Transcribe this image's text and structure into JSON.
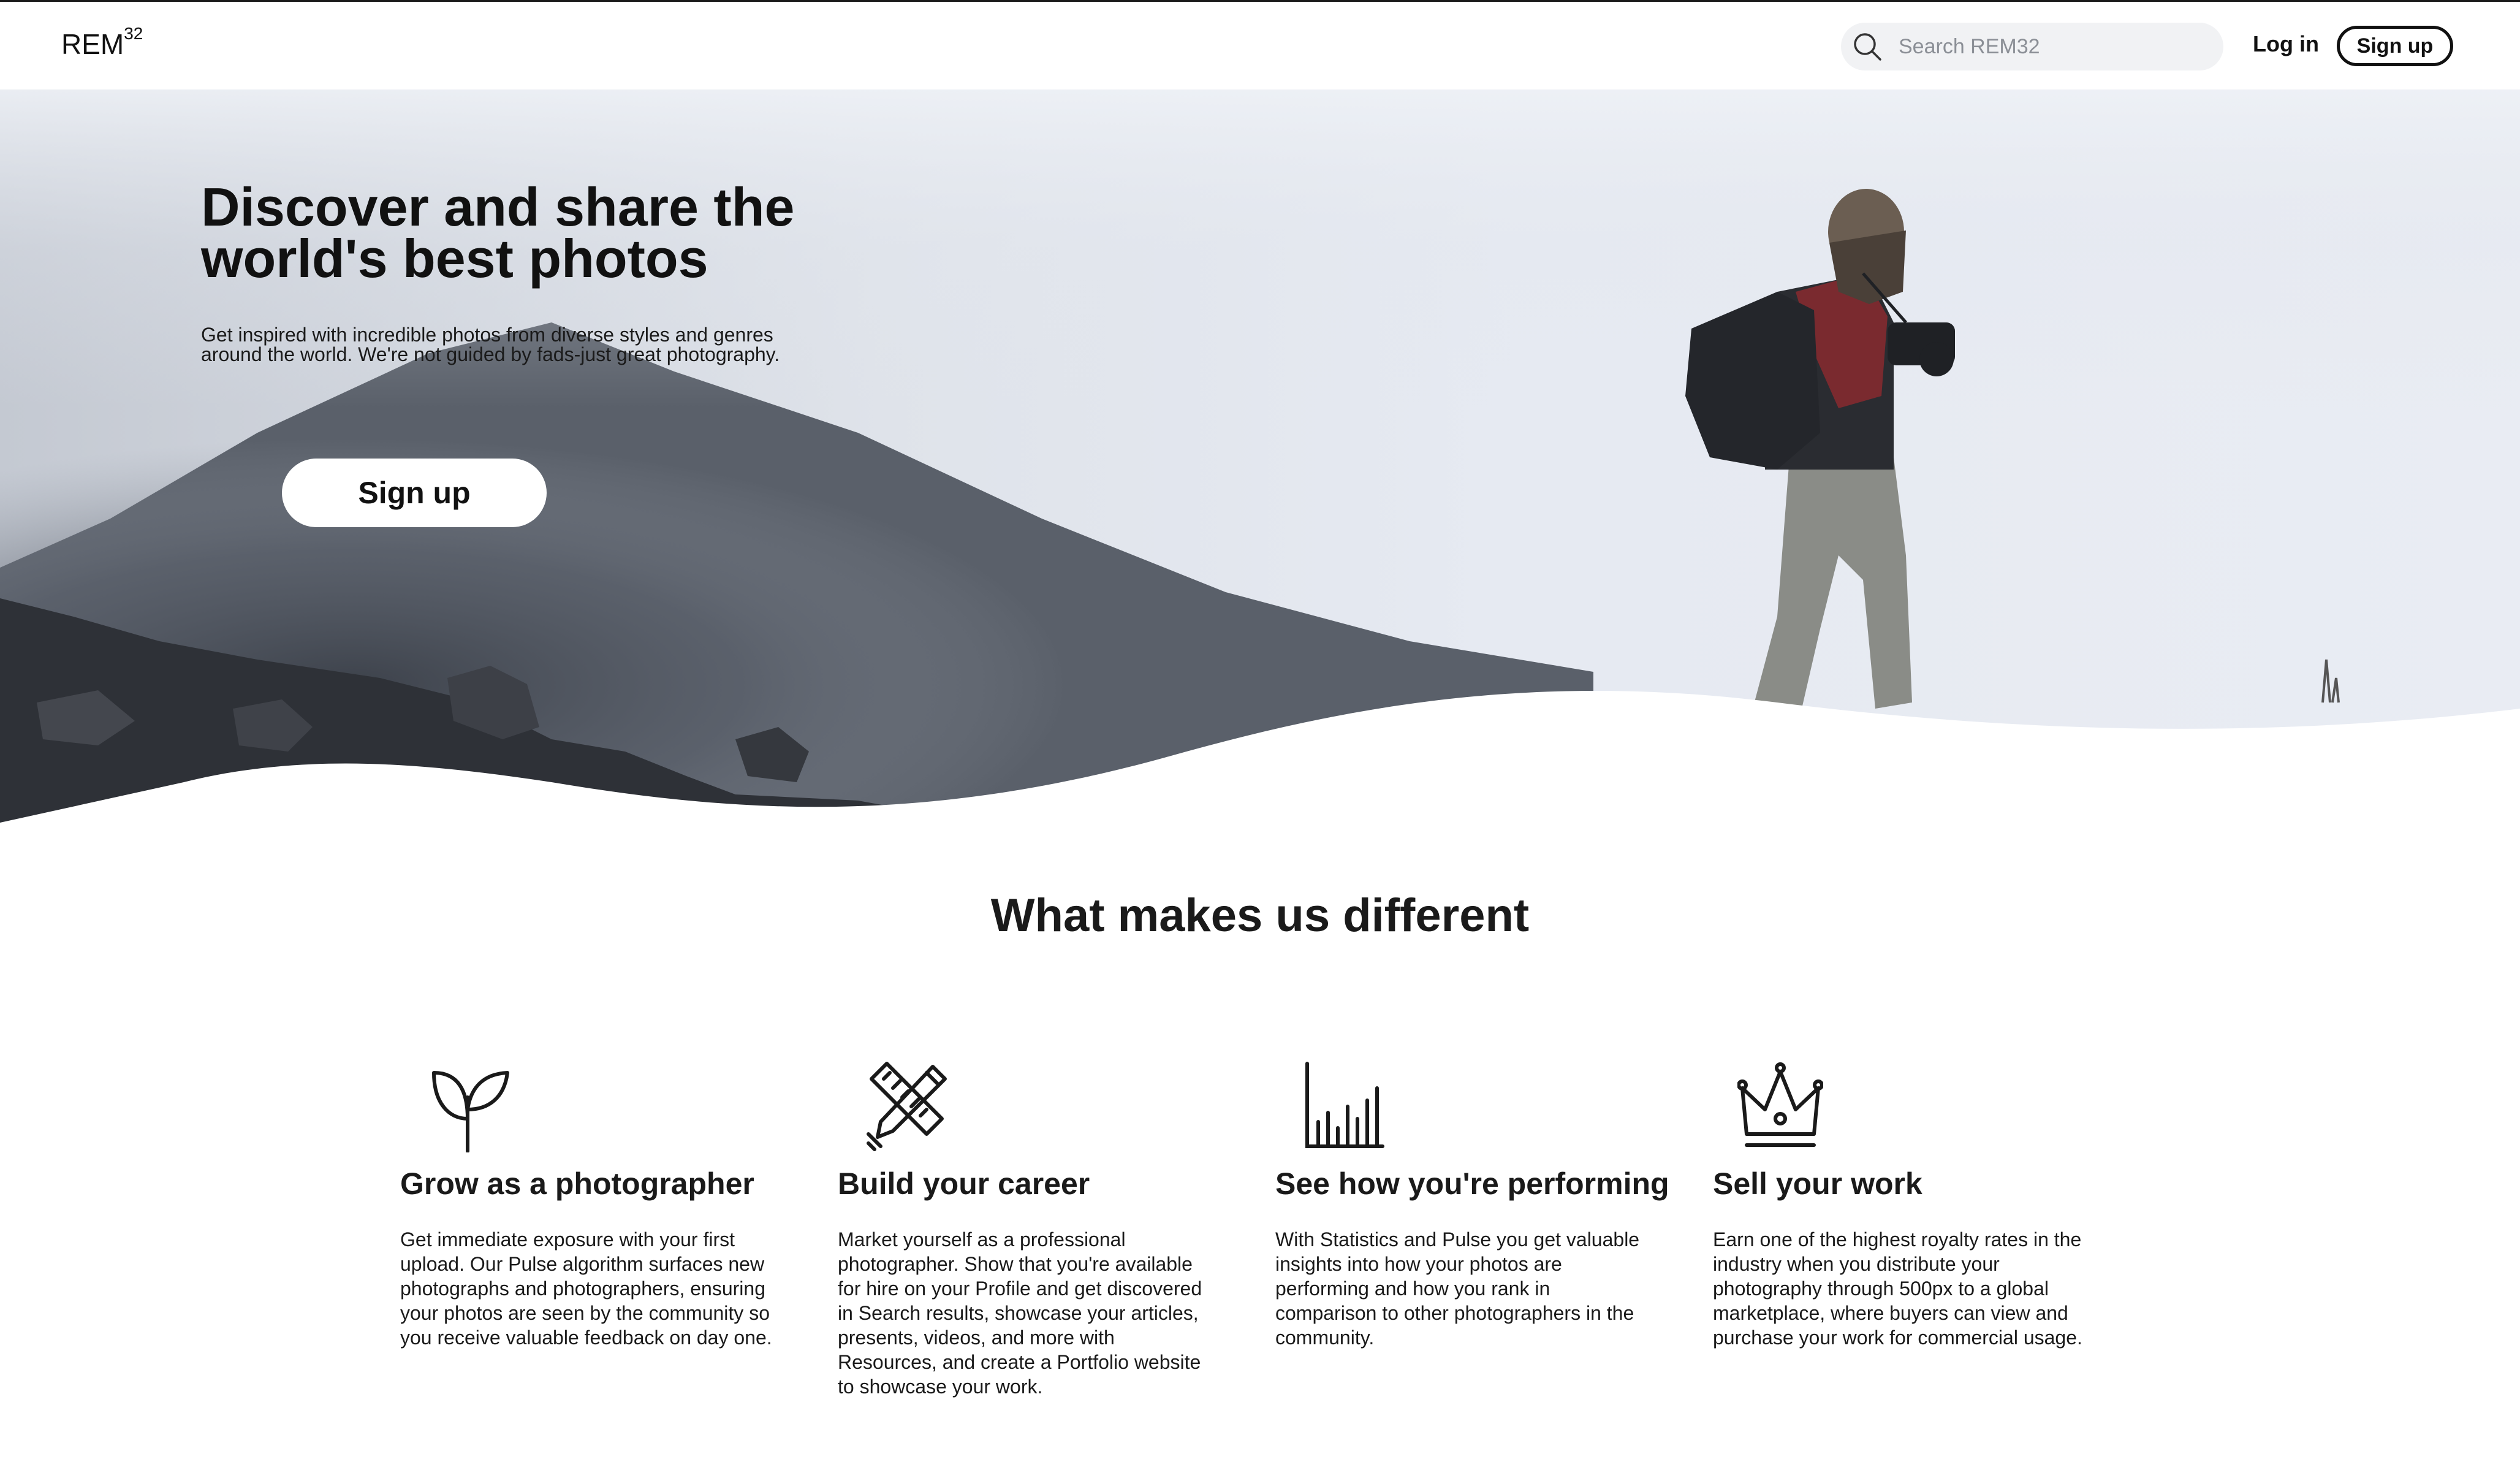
{
  "navbar": {
    "logo_text": "REM",
    "logo_sup": "32",
    "search_placeholder": "Search REM32",
    "login_label": "Log in",
    "signup_label": "Sign up"
  },
  "hero": {
    "title": "Discover and share the world's best photos",
    "subtitle_line1": "Get inspired with incredible photos from diverse styles and genres",
    "subtitle_line2": "around the world. We're not guided by fads-just great photography.",
    "cta_label": "Sign up"
  },
  "section": {
    "title": "What makes us different",
    "features": [
      {
        "icon": "sprout-icon",
        "title": "Grow as a photographer",
        "description": "Get immediate exposure with your first upload. Our Pulse algorithm surfaces new photographs and photographers, ensuring your photos are seen by the community so you receive valuable feedback on day one."
      },
      {
        "icon": "pencil-ruler-icon",
        "title": "Build your career",
        "description": "Market yourself as a professional photographer. Show that you're available for hire on your Profile and get discovered in Search results, showcase your articles, presents, videos, and more with Resources, and create a Portfolio website to showcase your work."
      },
      {
        "icon": "bar-chart-icon",
        "title": "See how you're performing",
        "description": "With Statistics and Pulse you get valuable insights into how your photos are performing and how you rank in comparison to other photographers in the community."
      },
      {
        "icon": "crown-icon",
        "title": "Sell your work",
        "description": "Earn one of the highest royalty rates in the industry when you distribute your photography through 500px to a global marketplace, where buyers can view and purchase your work for commercial usage."
      }
    ]
  },
  "colors": {
    "text": "#1a1a1a",
    "search_bg": "#f1f2f4",
    "placeholder": "#8b8f96",
    "sky_light": "#e4e9f2",
    "mountain_dark": "#3a3d44"
  }
}
